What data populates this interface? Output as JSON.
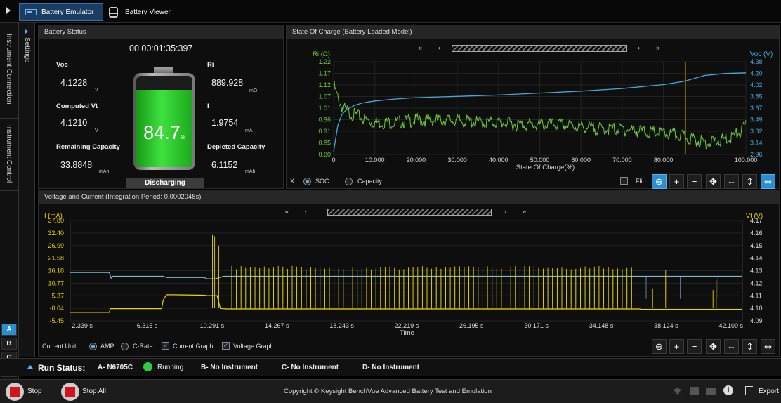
{
  "tabs": {
    "emulator": "Battery Emulator",
    "viewer": "Battery Viewer"
  },
  "left_rail": {
    "connection": "Instrument Connection",
    "control": "Instrument Control",
    "units": [
      "A",
      "B",
      "C",
      "D"
    ]
  },
  "settings_label": "Settings",
  "battery_status": {
    "title": "Battery Status",
    "elapsed": "00.00:01:35:397",
    "voc_label": "Voc",
    "voc_value": "4.1228",
    "voc_unit": "V",
    "computed_vt_label": "Computed Vt",
    "computed_vt_value": "4.1210",
    "computed_vt_unit": "V",
    "remaining_label": "Remaining Capacity",
    "remaining_value": "33.8848",
    "remaining_unit": "mAh",
    "ri_label": "Ri",
    "ri_value": "889.928",
    "ri_unit": "mΩ",
    "i_label": "I",
    "i_value": "1.9754",
    "i_unit": "mA",
    "depleted_label": "Depleted Capacity",
    "depleted_value": "6.1152",
    "depleted_unit": "mAh",
    "battery_percent": "84.7",
    "battery_percent_unit": "%",
    "battery_level": 0.847,
    "state": "Discharging"
  },
  "soc_panel": {
    "title": "State Of Charge (Battery Loaded Model)",
    "x_label": "X:",
    "x_soc": "SOC",
    "x_capacity": "Capacity",
    "flip_label": "Flip",
    "nav": [
      "«",
      "‹",
      "›",
      "»"
    ]
  },
  "vc_panel": {
    "title": "Voltage and Current (Integration Period: 0.0002048s)",
    "current_unit_label": "Current Unit:",
    "amp_label": "AMP",
    "crate_label": "C-Rate",
    "current_graph_label": "Current Graph",
    "voltage_graph_label": "Voltage Graph",
    "nav": [
      "«",
      "‹",
      "›",
      "»"
    ]
  },
  "chart_data": [
    {
      "type": "line",
      "title": "",
      "xlabel": "State Of Charge(%)",
      "ylabel_left": "Ri (Ω)",
      "ylabel_right": "Voc (V)",
      "xlim": [
        0,
        100
      ],
      "ylim_left": [
        0.8,
        1.22
      ],
      "ylim_right": [
        2.96,
        4.38
      ],
      "x_ticks": [
        "0",
        "10.000",
        "20.000",
        "30.000",
        "40.000",
        "50.000",
        "60.000",
        "70.000",
        "80.000",
        "100.000"
      ],
      "x_tick_values": [
        0,
        10,
        20,
        30,
        40,
        50,
        60,
        70,
        80,
        100
      ],
      "y_ticks_left": [
        "0.80",
        "0.85",
        "0.91",
        "0.96",
        "1.01",
        "1.07",
        "1.12",
        "1.17",
        "1.22"
      ],
      "y_ticks_right": [
        "2.96",
        "3.14",
        "3.32",
        "3.49",
        "3.67",
        "3.85",
        "4.02",
        "4.20",
        "4.38"
      ],
      "cursor_x": 85.3,
      "series": [
        {
          "name": "Voc (V)",
          "axis": "right",
          "color": "#47a8d8",
          "x": [
            0,
            0.5,
            1,
            2,
            3,
            5,
            7,
            10,
            15,
            20,
            30,
            40,
            50,
            60,
            70,
            80,
            85,
            90,
            95,
            100
          ],
          "y": [
            3.0,
            3.2,
            3.4,
            3.57,
            3.64,
            3.71,
            3.75,
            3.78,
            3.81,
            3.83,
            3.85,
            3.87,
            3.9,
            3.93,
            3.97,
            4.03,
            4.08,
            4.17,
            4.2,
            4.21
          ]
        },
        {
          "name": "Ri (Ω)",
          "axis": "left",
          "color": "#6bc93a",
          "x": [
            0,
            0.5,
            1,
            2,
            4,
            6,
            8,
            10,
            15,
            20,
            25,
            30,
            35,
            40,
            45,
            50,
            55,
            60,
            65,
            70,
            75,
            80,
            84,
            86,
            88,
            90,
            92,
            94,
            96,
            98,
            99,
            100
          ],
          "y": [
            1.13,
            1.1,
            1.07,
            1.03,
            1.0,
            0.99,
            0.97,
            0.96,
            0.96,
            0.97,
            0.97,
            0.97,
            0.96,
            0.96,
            0.95,
            0.95,
            0.95,
            0.94,
            0.93,
            0.93,
            0.92,
            0.91,
            0.9,
            0.89,
            0.88,
            0.87,
            0.87,
            0.88,
            0.89,
            0.91,
            0.92,
            0.95
          ]
        }
      ]
    },
    {
      "type": "line",
      "title": "",
      "xlabel": "Time",
      "ylabel_left": "I (mA)",
      "ylabel_right": "Vt (V)",
      "xlim": [
        1.6,
        42.8
      ],
      "ylim_left": [
        -5.45,
        37.8
      ],
      "ylim_right": [
        4.09,
        4.17
      ],
      "x_ticks": [
        "2.339 s",
        "6.315 s",
        "10.291 s",
        "14.267 s",
        "18.243 s",
        "22.219 s",
        "26.195 s",
        "30.171 s",
        "34.148 s",
        "38.124 s",
        "42.100 s"
      ],
      "x_tick_values": [
        2.339,
        6.315,
        10.291,
        14.267,
        18.243,
        22.219,
        26.195,
        30.171,
        34.148,
        38.124,
        42.1
      ],
      "y_ticks_left": [
        "-5.45",
        "-0.04",
        "5.37",
        "10.77",
        "16.18",
        "21.58",
        "26.99",
        "32.40",
        "37.80"
      ],
      "y_ticks_right": [
        "4.09",
        "4.10",
        "4.11",
        "4.12",
        "4.13",
        "4.14",
        "4.15",
        "4.16",
        "4.17"
      ],
      "series": [
        {
          "name": "I (mA)",
          "axis": "left",
          "color": "#e8d400",
          "baseline_x": [
            1.6,
            4.0,
            4.05,
            7.2,
            7.3,
            7.5,
            9.8,
            10.0,
            10.6,
            10.8,
            11.2,
            36.5,
            36.6,
            42.8
          ],
          "baseline_y": [
            -1.8,
            -1.8,
            -0.2,
            -0.2,
            3.5,
            5.8,
            5.6,
            5.4,
            5.4,
            -0.1,
            -0.3,
            -0.3,
            -0.5,
            -0.5
          ],
          "pulse_start": 11.5,
          "pulse_end": 36.2,
          "pulse_period": 0.285,
          "pulse_peak": 18.2,
          "extra_spikes": [
            [
              10.32,
              31.5
            ],
            [
              10.45,
              31.0
            ],
            [
              10.7,
              27.0
            ],
            [
              38.1,
              16.5
            ],
            [
              37.3,
              8.5
            ],
            [
              41.0,
              7.8
            ],
            [
              41.2,
              12.0
            ]
          ]
        },
        {
          "name": "Vt (V)",
          "axis": "right",
          "color": "#7fb8d6",
          "baseline_x": [
            1.6,
            4.0,
            4.1,
            4.2,
            7.3,
            7.5,
            9.8,
            10.0,
            10.5,
            11.0,
            42.8
          ],
          "baseline_y": [
            4.1285,
            4.1285,
            4.124,
            4.1255,
            4.1255,
            4.1245,
            4.1245,
            4.1235,
            4.1235,
            4.1255,
            4.1255
          ],
          "dip_start": 11.5,
          "dip_end": 36.2,
          "dip_value": 4.1035,
          "late_dips": [
            36.9,
            38.1,
            39.0,
            40.2,
            41.3
          ]
        }
      ]
    }
  ],
  "run_status": {
    "label": "Run Status:",
    "a_label": "A- N6705C",
    "a_state": "Running",
    "b_label": "B- No Instrument",
    "c_label": "C- No Instrument",
    "d_label": "D- No Instrument",
    "running_color": "#2ecc40"
  },
  "bottom": {
    "stop": "Stop",
    "stop_all": "Stop All",
    "copyright": "Copyright © Keysight BenchVue Advanced Battery Test and Emulation",
    "export": "Export",
    "stop_color": "#d0141b"
  }
}
